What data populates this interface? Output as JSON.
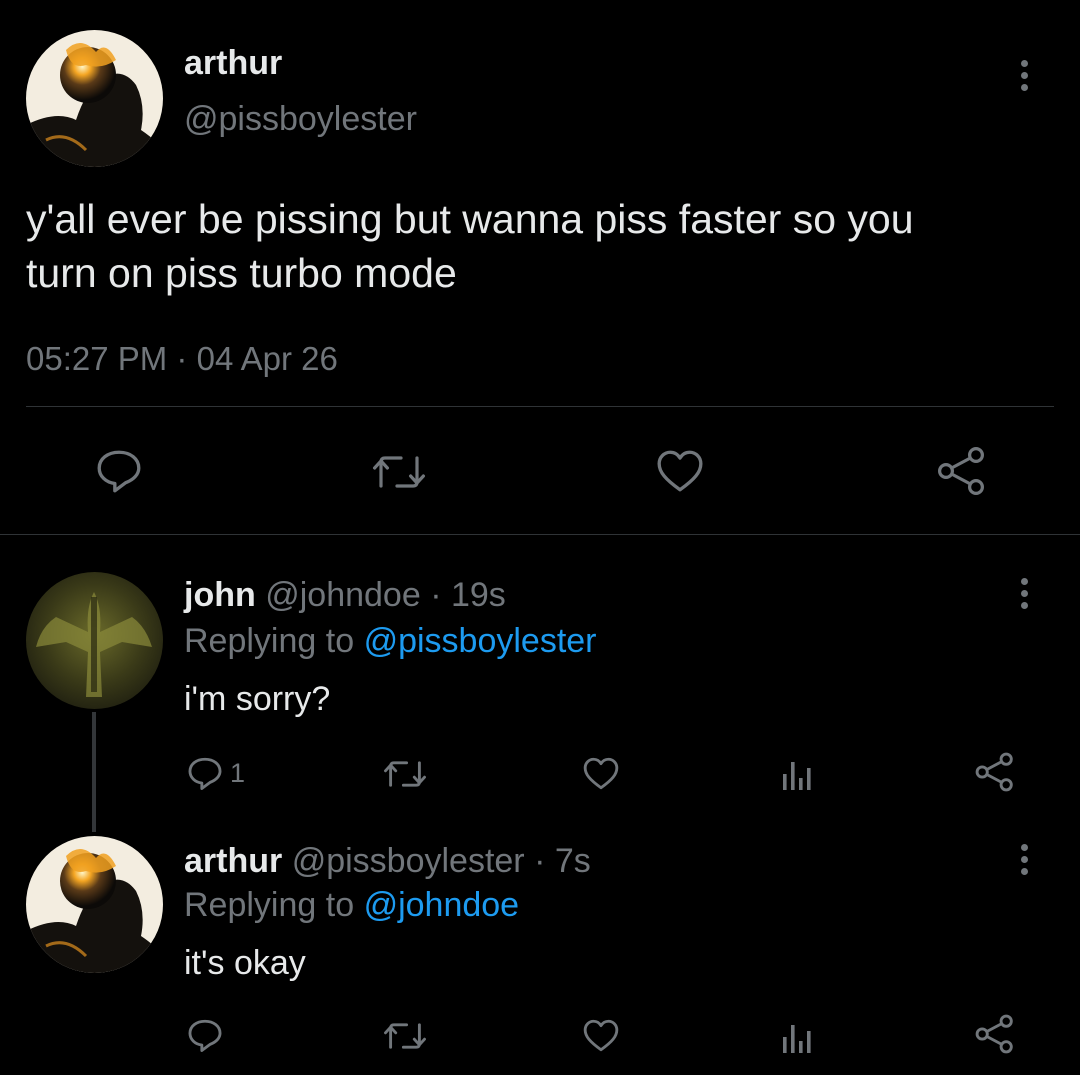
{
  "main_tweet": {
    "name": "arthur",
    "handle": "@pissboylester",
    "text_line1": "y'all ever be pissing but wanna piss faster so you",
    "text_line2": "turn on piss turbo mode",
    "time": "05:27 PM",
    "sep": "·",
    "date": "04 Apr 26"
  },
  "reply1": {
    "name": "john",
    "handle": "@johndoe",
    "age": "· 19s",
    "replying_prefix": "Replying to",
    "replying_to": "@pissboylester",
    "text": "i'm sorry?",
    "reply_count": "1"
  },
  "reply2": {
    "name": "arthur",
    "handle": "@pissboylester",
    "age": "· 7s",
    "replying_prefix": "Replying to",
    "replying_to": "@johndoe",
    "text": "it's okay"
  },
  "icons": [
    "reply-icon",
    "retweet-icon",
    "like-icon",
    "analytics-icon",
    "share-icon",
    "more-icon"
  ],
  "colors": {
    "background": "#000000",
    "text": "#e7e9ea",
    "secondary": "#71767b",
    "link": "#1d9bf0",
    "divider": "#2f3336"
  }
}
